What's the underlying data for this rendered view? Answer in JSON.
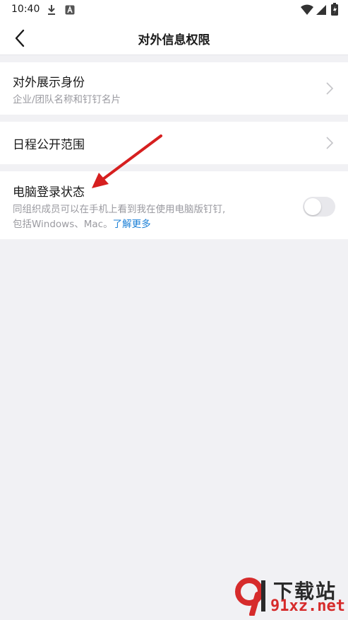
{
  "status_bar": {
    "time": "10:40"
  },
  "header": {
    "title": "对外信息权限"
  },
  "settings": [
    {
      "title": "对外展示身份",
      "subtitle": "企业/团队名称和钉钉名片"
    },
    {
      "title": "日程公开范围"
    }
  ],
  "pc_login": {
    "title": "电脑登录状态",
    "description_line1": "同组织成员可以在手机上看到我在使用电脑版钉钉,",
    "description_line2": "包括Windows、Mac。",
    "learn_more": "了解更多",
    "toggle_on": false
  },
  "watermark": {
    "line1": "下载站",
    "line2": "91xz.net"
  },
  "colors": {
    "accent": "#1a7fd6",
    "annotation": "#d61f1f"
  }
}
